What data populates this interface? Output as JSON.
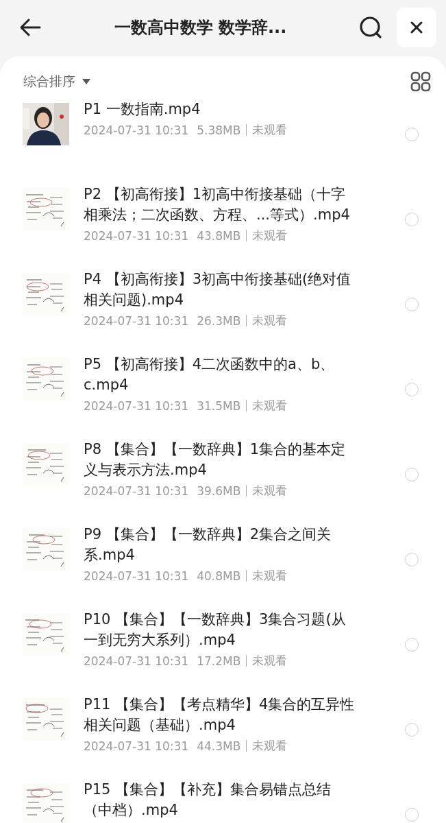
{
  "header": {
    "title": "一数高中数学 数学辞..."
  },
  "toolbar": {
    "sort_label": "综合排序"
  },
  "files": [
    {
      "title": "P1 一数指南.mp4",
      "date": "2024-07-31 10:31",
      "size": "5.38MB",
      "status": "未观看",
      "selected": false,
      "kind": "picture"
    },
    {
      "title": "P2 【初高衔接】1初高中衔接基础（十字相乘法；二次函数、方程、...等式）.mp4",
      "date": "2024-07-31 10:31",
      "size": "43.8MB",
      "status": "未观看",
      "selected": false,
      "kind": "picture"
    },
    {
      "title": "P4 【初高衔接】3初高中衔接基础(绝对值相关问题).mp4",
      "date": "2024-07-31 10:31",
      "size": "26.3MB",
      "status": "未观看",
      "selected": false,
      "kind": "picture"
    },
    {
      "title": "P5 【初高衔接】4二次函数中的a、b、c.mp4",
      "date": "2024-07-31 10:31",
      "size": "31.5MB",
      "status": "未观看",
      "selected": false,
      "kind": "picture"
    },
    {
      "title": "P8 【集合】【一数辞典】1集合的基本定义与表示方法.mp4",
      "date": "2024-07-31 10:31",
      "size": "39.6MB",
      "status": "未观看",
      "selected": false,
      "kind": "picture"
    },
    {
      "title": "P9 【集合】【一数辞典】2集合之间关系.mp4",
      "date": "2024-07-31 10:31",
      "size": "40.8MB",
      "status": "未观看",
      "selected": false,
      "kind": "picture"
    },
    {
      "title": "P10 【集合】【一数辞典】3集合习题(从一到无穷大系列）.mp4",
      "date": "2024-07-31 10:31",
      "size": "17.2MB",
      "status": "未观看",
      "selected": false,
      "kind": "picture"
    },
    {
      "title": "P11 【集合】【考点精华】4集合的互异性相关问题（基础）.mp4",
      "date": "2024-07-31 10:31",
      "size": "44.3MB",
      "status": "未观看",
      "selected": false,
      "kind": "picture"
    },
    {
      "title": "P15 【集合】【补充】集合易错点总结（中档）.mp4",
      "selected": false,
      "kind": "picture"
    }
  ]
}
